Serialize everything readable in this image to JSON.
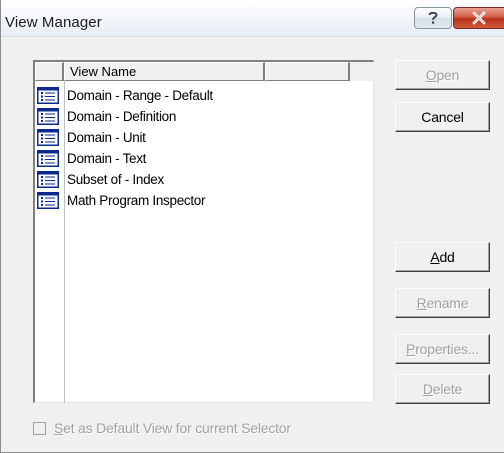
{
  "window": {
    "title": "View Manager",
    "help_label": "?",
    "close_label": "X"
  },
  "list": {
    "columns": [
      "",
      "View Name",
      ""
    ],
    "items": [
      {
        "label": "Domain - Range - Default",
        "icon": "view-list-icon"
      },
      {
        "label": "Domain - Definition",
        "icon": "view-list-icon"
      },
      {
        "label": "Domain - Unit",
        "icon": "view-list-icon"
      },
      {
        "label": "Domain - Text",
        "icon": "view-list-icon"
      },
      {
        "label": "Subset of - Index",
        "icon": "view-list-icon"
      },
      {
        "label": "Math Program Inspector",
        "icon": "view-list-icon"
      }
    ]
  },
  "buttons": {
    "open": {
      "label": "Open",
      "enabled": false
    },
    "cancel": {
      "label": "Cancel",
      "enabled": true
    },
    "add": {
      "label": "Add",
      "enabled": true
    },
    "rename": {
      "label": "Rename",
      "enabled": false
    },
    "properties": {
      "label": "Properties...",
      "enabled": false
    },
    "delete": {
      "label": "Delete",
      "enabled": false
    }
  },
  "default_checkbox": {
    "label": "Set as Default View for current Selector",
    "checked": false,
    "enabled": false
  },
  "colors": {
    "icon_blue": "#0a2a8c",
    "close_red": "#c8452e"
  }
}
